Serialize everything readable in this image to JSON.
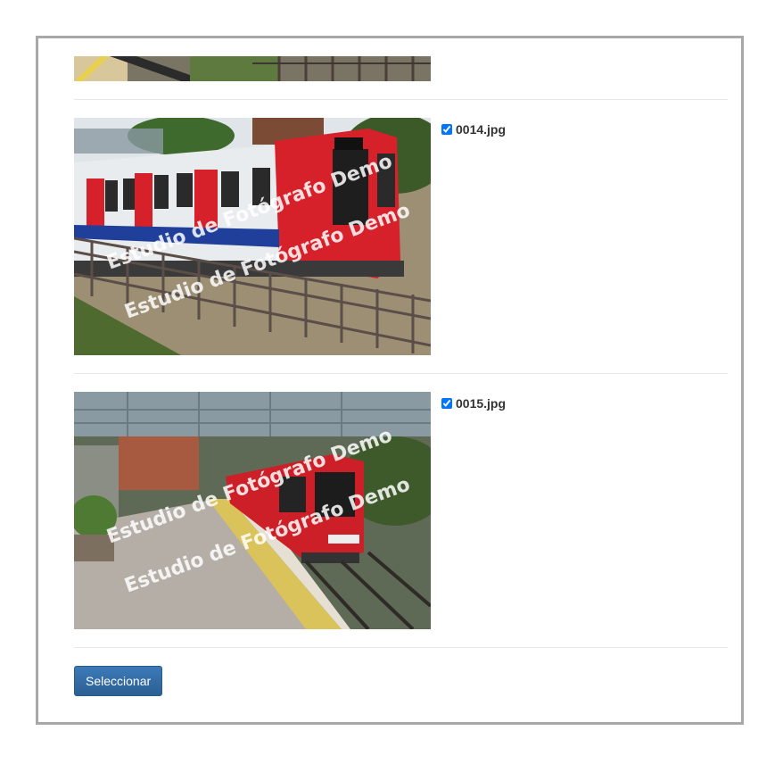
{
  "images": [
    {
      "filename": "",
      "checked": false,
      "watermark": "Estudio de Fotógrafo Demo"
    },
    {
      "filename": "0014.jpg",
      "checked": true,
      "watermark": "Estudio de Fotógrafo Demo"
    },
    {
      "filename": "0015.jpg",
      "checked": true,
      "watermark": "Estudio de Fotógrafo Demo"
    }
  ],
  "actions": {
    "select_label": "Seleccionar"
  },
  "colors": {
    "button": "#2f6ca3",
    "train_red": "#d6202a",
    "panel_border": "#a8a8a8"
  }
}
